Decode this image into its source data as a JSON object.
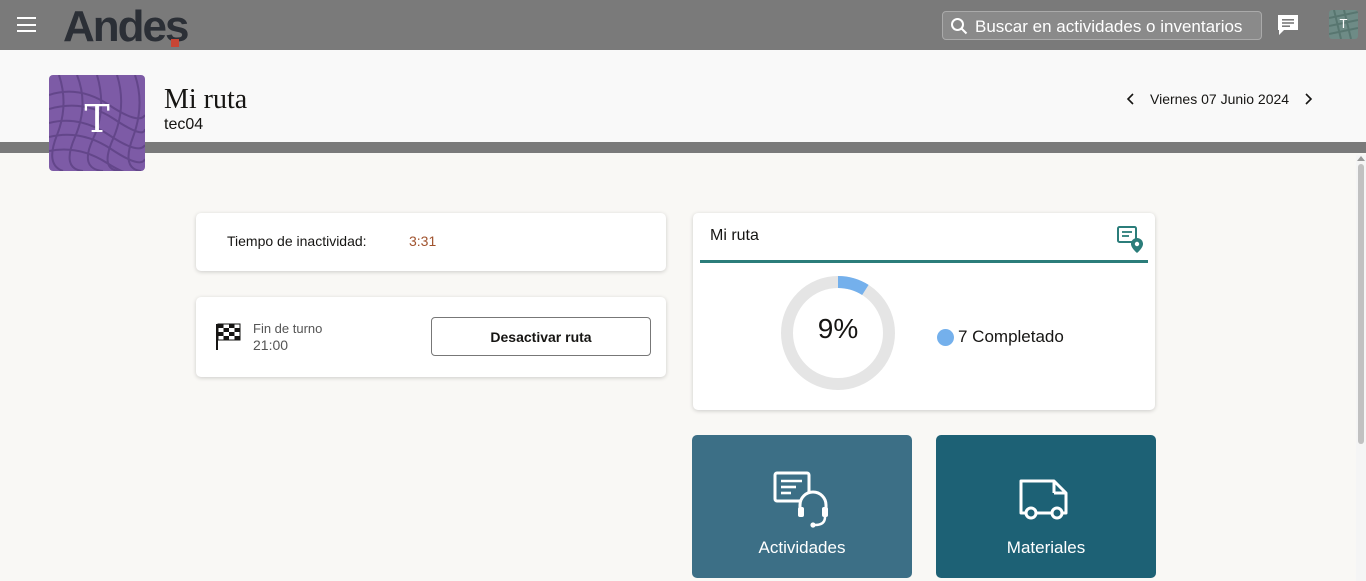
{
  "topbar": {
    "logo_text": "Andes",
    "search_placeholder": "Buscar en actividades o inventarios",
    "user_initial": "T"
  },
  "header": {
    "avatar_initial": "T",
    "title": "Mi ruta",
    "subtitle": "tec04",
    "date": "Viernes 07 Junio 2024"
  },
  "idle": {
    "label": "Tiempo de inactividad:",
    "value": "3:31"
  },
  "shift": {
    "label": "Fin de turno",
    "time": "21:00",
    "button_label": "Desactivar ruta"
  },
  "route": {
    "title": "Mi ruta",
    "percent_text": "9%",
    "progress_fraction": 0.09,
    "legend_label": "7 Completado",
    "legend_color": "#74b0ec",
    "track_color": "#e5e5e5",
    "accent_color": "#2b7d7a"
  },
  "tiles": {
    "activities_label": "Actividades",
    "materials_label": "Materiales"
  },
  "icons": {
    "menu": "hamburger-menu-icon",
    "search": "search-icon",
    "chat": "chat-icon",
    "route": "route-map-pin-icon",
    "flag": "checkered-flag-icon",
    "activities": "activities-headset-icon",
    "materials": "delivery-truck-icon"
  }
}
